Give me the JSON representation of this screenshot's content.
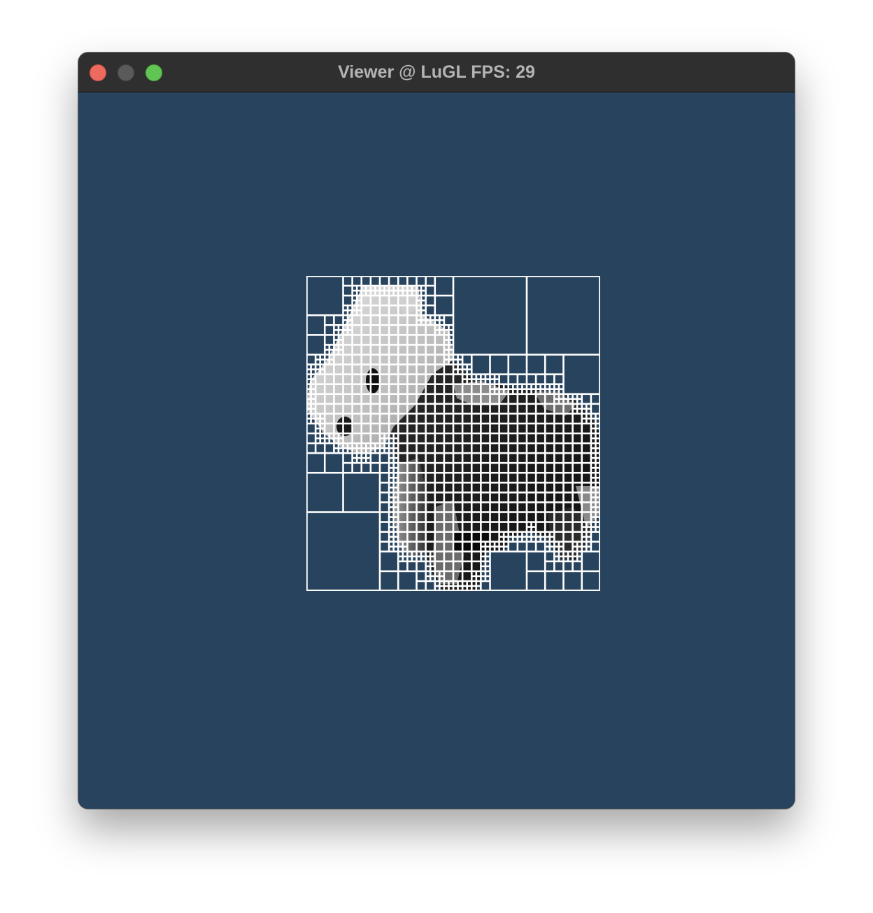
{
  "window": {
    "title": "Viewer @ LuGL FPS: 29",
    "buttons": {
      "close": "close-button",
      "minimize": "minimize-button",
      "zoom": "zoom-button"
    }
  },
  "viewport": {
    "background": "#28435d",
    "content": "quadtree over grayscale voxel horse render",
    "grid_color": "#ffffff"
  }
}
